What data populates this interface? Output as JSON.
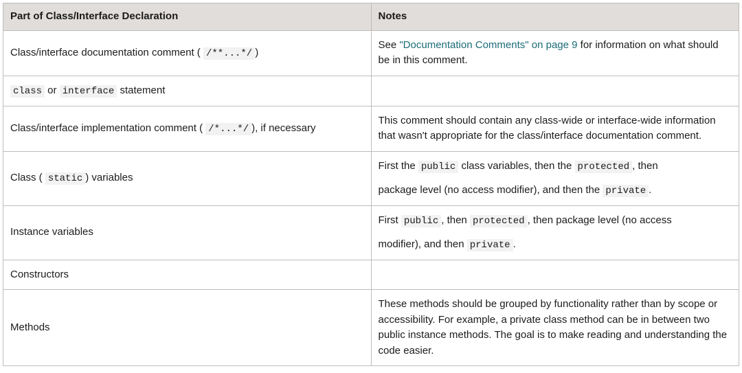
{
  "table": {
    "headers": {
      "col1": "Part of Class/Interface Declaration",
      "col2": "Notes"
    },
    "rows": [
      {
        "col1": {
          "parts": [
            {
              "text": "Class/interface documentation comment ( "
            },
            {
              "code": "/**...*/"
            },
            {
              "text": ")"
            }
          ]
        },
        "col2": {
          "parts": [
            {
              "text": "See "
            },
            {
              "link": "\"Documentation Comments\" on page 9"
            },
            {
              "text": " for information on what should be in this comment."
            }
          ]
        }
      },
      {
        "col1": {
          "parts": [
            {
              "code": "class"
            },
            {
              "text": " or "
            },
            {
              "code": "interface"
            },
            {
              "text": " statement"
            }
          ]
        },
        "col2": {
          "parts": []
        }
      },
      {
        "col1": {
          "parts": [
            {
              "text": "Class/interface implementation comment ( "
            },
            {
              "code": "/*...*/"
            },
            {
              "text": "), if necessary"
            }
          ]
        },
        "col2": {
          "parts": [
            {
              "text": "This comment should contain any class-wide or interface-wide information that wasn't appropriate for the class/interface documentation comment."
            }
          ]
        }
      },
      {
        "col1": {
          "parts": [
            {
              "text": "Class ( "
            },
            {
              "code": "static"
            },
            {
              "text": ") variables"
            }
          ]
        },
        "col2": {
          "blocks": [
            {
              "parts": [
                {
                  "text": "First the "
                },
                {
                  "code": "public"
                },
                {
                  "text": " class variables, then the "
                },
                {
                  "code": "protected"
                },
                {
                  "text": ", then"
                }
              ]
            },
            {
              "parts": [
                {
                  "text": "package level (no access modifier), and then the "
                },
                {
                  "code": "private"
                },
                {
                  "text": "."
                }
              ]
            }
          ]
        }
      },
      {
        "col1": {
          "parts": [
            {
              "text": "Instance variables"
            }
          ]
        },
        "col2": {
          "blocks": [
            {
              "parts": [
                {
                  "text": "First "
                },
                {
                  "code": "public"
                },
                {
                  "text": ", then "
                },
                {
                  "code": "protected"
                },
                {
                  "text": ", then package level (no access"
                }
              ]
            },
            {
              "parts": [
                {
                  "text": "modifier), and then "
                },
                {
                  "code": "private"
                },
                {
                  "text": "."
                }
              ]
            }
          ]
        }
      },
      {
        "col1": {
          "parts": [
            {
              "text": "Constructors"
            }
          ]
        },
        "col2": {
          "parts": []
        }
      },
      {
        "col1": {
          "parts": [
            {
              "text": "Methods"
            }
          ]
        },
        "col2": {
          "parts": [
            {
              "text": "These methods should be grouped by functionality rather than by scope or accessibility. For example, a private class method can be in between two public instance methods. The goal is to make reading and understanding the code easier."
            }
          ]
        }
      }
    ]
  }
}
